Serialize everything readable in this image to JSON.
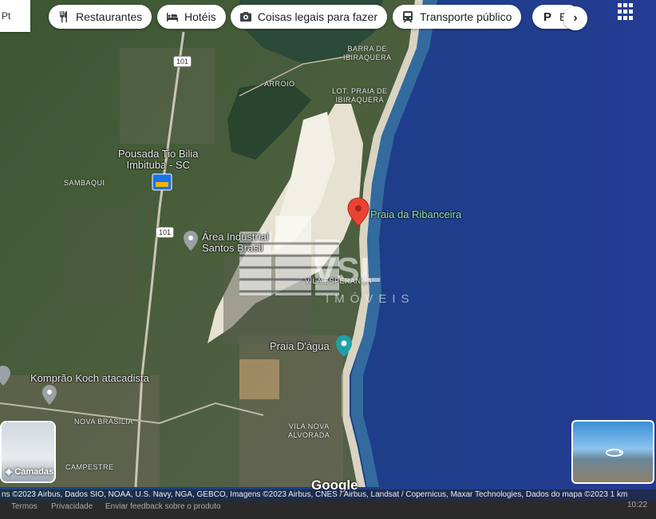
{
  "search": {
    "text": "Pt"
  },
  "chips": [
    {
      "label": "Restaurantes",
      "icon": "fork-knife-icon"
    },
    {
      "label": "Hotéis",
      "icon": "bed-icon"
    },
    {
      "label": "Coisas legais para fazer",
      "icon": "camera-icon"
    },
    {
      "label": "Transporte público",
      "icon": "train-icon"
    },
    {
      "label": "E",
      "icon": "parking-icon"
    }
  ],
  "places": {
    "praia_ribanceira": "Praia da Ribanceira",
    "pousada": "Pousada Tio Bilia\nImbituba - SC",
    "area_industrial": "Área Industrial\nSantos Brasil",
    "praia_dagua": "Praia D'água",
    "komprao": "Komprão Koch atacadista"
  },
  "areas": {
    "barra": "BARRA DE\nIBIRAQUERA",
    "lot_praia": "LOT. PRAIA DE\nIBIRAQUERA",
    "arroio": "ARROIO",
    "sambaqui": "SAMBAQUI",
    "vila_esperanca": "VILA ESPERANÇA",
    "nova_brasilia": "NOVA BRASÍLIA",
    "vila_nova": "VILA NOVA\nALVORADA",
    "campestre": "CAMPESTRE"
  },
  "roads": {
    "br101_a": "101",
    "br101_b": "101"
  },
  "watermark": {
    "brand": "VSL",
    "sub": "IMÓVEIS"
  },
  "controls": {
    "layers": "Camadas"
  },
  "google_logo": "Google",
  "attribution": "ns ©2023 Airbus, Dados SIO, NOAA, U.S. Navy, NGA, GEBCO, Imagens ©2023 Airbus, CNES / Airbus, Landsat / Copernicus, Maxar Technologies, Dados do mapa ©2023   1 km",
  "footer": {
    "terms": "Termos",
    "privacy": "Privacidade",
    "feedback": "Enviar feedback sobre o produto",
    "time": "10:22"
  },
  "colors": {
    "ocean": "#1d3f85",
    "land": "#3f5a33",
    "dunes": "#e6e1d0",
    "pin": "#ea4335"
  }
}
